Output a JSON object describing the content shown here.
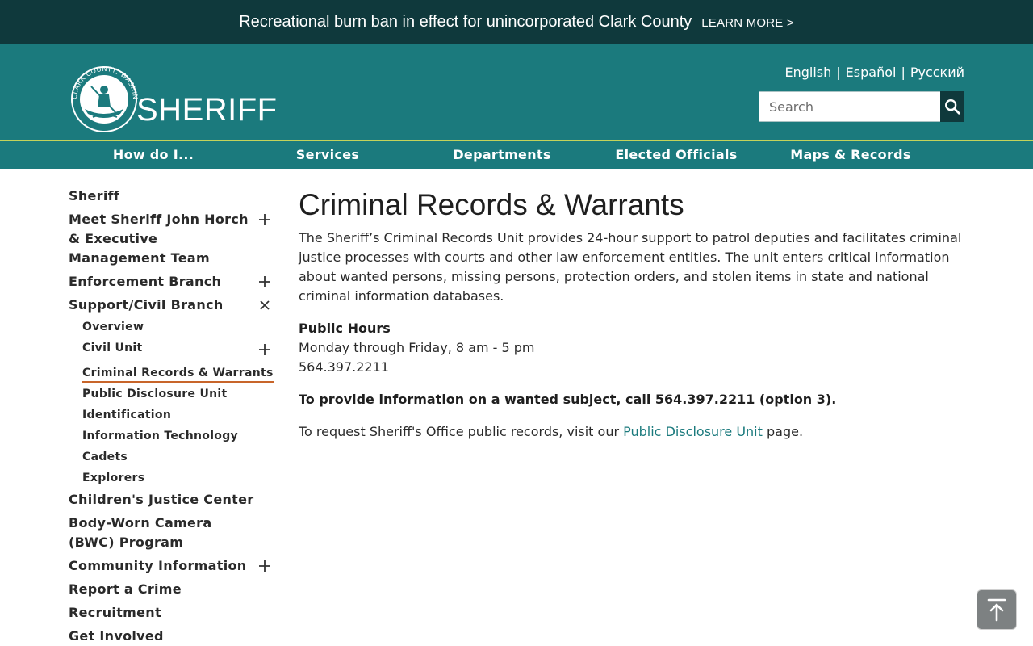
{
  "alert": {
    "text": "Recreational burn ban in effect for unincorporated Clark County",
    "link_label": "LEARN MORE >"
  },
  "header": {
    "seal_text": "CLARK COUNTY, WASHINGTON",
    "logo_word": "SHERIFF",
    "languages": [
      "English",
      "Español",
      "Русский"
    ],
    "separator": "|",
    "search_placeholder": "Search"
  },
  "nav": {
    "items": [
      "How do I...",
      "Services",
      "Departments",
      "Elected Officials",
      "Maps & Records"
    ]
  },
  "sidebar": {
    "top1": "Sheriff",
    "top2": "Meet Sheriff John Horch & Executive Management Team",
    "top3": "Enforcement Branch",
    "top4": "Support/Civil Branch",
    "sub": [
      "Overview",
      "Civil Unit",
      "Criminal Records & Warrants",
      "Public Disclosure Unit",
      "Identification",
      "Information Technology",
      "Cadets",
      "Explorers"
    ],
    "top5": "Children's Justice Center",
    "top6": "Body-Worn Camera (BWC) Program",
    "top7": "Community Information",
    "top8": "Report a Crime",
    "top9": "Recruitment",
    "top10": "Get Involved"
  },
  "main": {
    "title": "Criminal Records & Warrants",
    "intro": "The Sheriff’s Criminal Records Unit provides 24-hour support to patrol deputies and facilitates criminal justice processes with courts and other law enforcement entities. The unit enters critical information about wanted persons, missing persons, protection orders, and stolen items in state and national criminal information databases.",
    "hours_heading": "Public Hours",
    "hours_days": "Monday through Friday, 8 am - 5 pm",
    "phone": "564.397.2211",
    "wanted": "To provide information on a wanted subject, call 564.397.2211 (option 3).",
    "request_prefix": "To request Sheriff's Office public records, visit our ",
    "request_link": "Public Disclosure Unit",
    "request_suffix": " page."
  },
  "colors": {
    "alert_bg": "#0f393c",
    "header_teal": "#1b7a7d",
    "accent_line": "#c4d35a",
    "active_underline": "#c8652a"
  },
  "icons": {
    "search": "search-icon",
    "expand": "plus-icon",
    "collapse": "close-icon",
    "back_to_top": "arrow-up-to-line-icon"
  }
}
